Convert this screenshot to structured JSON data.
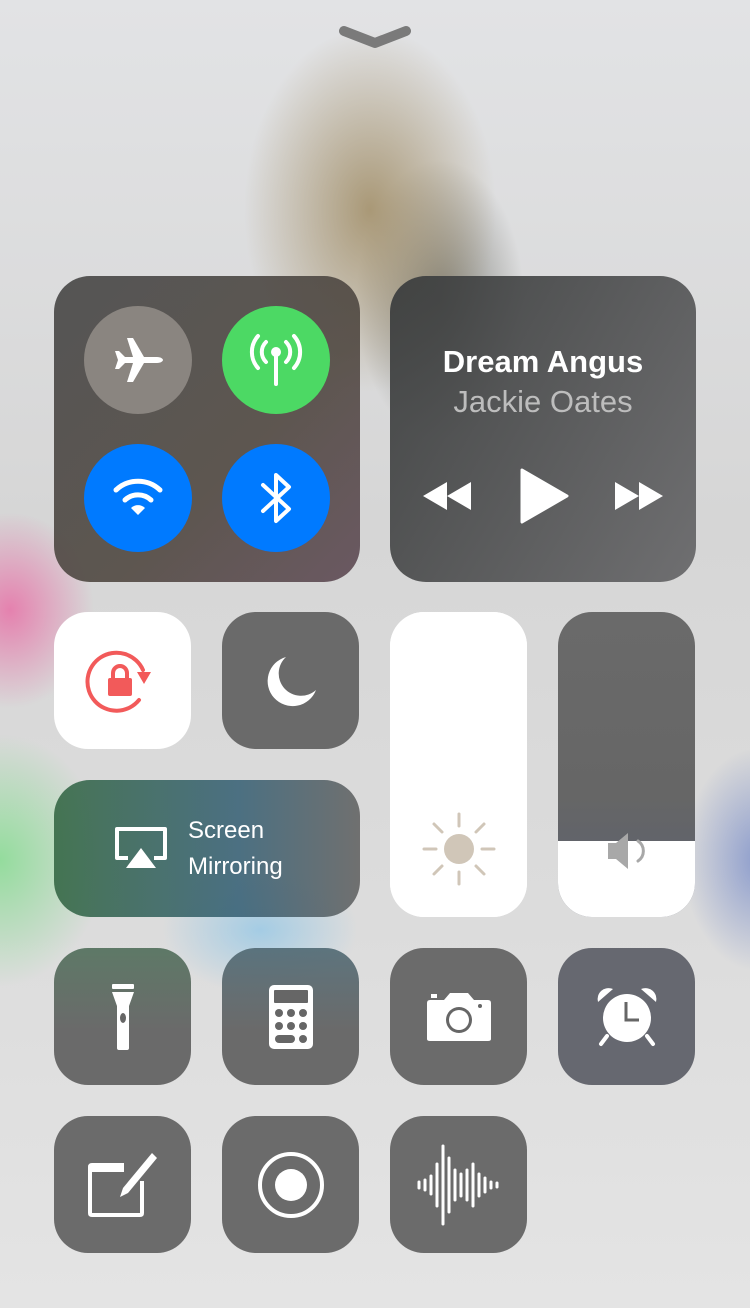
{
  "screen": "Control Center",
  "dismiss_handle": {
    "icon": "chevron-down-icon"
  },
  "connectivity": {
    "airplane_mode": {
      "icon": "airplane-icon",
      "state": "off",
      "color": "#8a8580"
    },
    "cellular_data": {
      "icon": "antenna-icon",
      "state": "on",
      "color": "#4cd964"
    },
    "wifi": {
      "icon": "wifi-icon",
      "state": "on",
      "color": "#007aff"
    },
    "bluetooth": {
      "icon": "bluetooth-icon",
      "state": "on",
      "color": "#007aff"
    }
  },
  "now_playing": {
    "title": "Dream Angus",
    "artist": "Jackie Oates",
    "controls": [
      "rewind-icon",
      "play-icon",
      "fast-forward-icon"
    ]
  },
  "orientation_lock": {
    "icon": "rotation-lock-icon",
    "state": "on",
    "color": "#f25a5a"
  },
  "do_not_disturb": {
    "icon": "moon-icon",
    "state": "off"
  },
  "screen_mirroring": {
    "icon": "airplay-icon",
    "label_line1": "Screen",
    "label_line2": "Mirroring"
  },
  "brightness": {
    "icon": "sun-icon",
    "level_percent": 100,
    "icon_color": "#d0c6b8"
  },
  "volume": {
    "icon": "speaker-icon",
    "level_percent": 25
  },
  "shortcuts_row1": [
    "flashlight-icon",
    "calculator-icon",
    "camera-icon",
    "alarm-clock-icon"
  ],
  "shortcuts_row2": [
    "notes-icon",
    "screen-record-icon",
    "voice-memos-icon"
  ]
}
